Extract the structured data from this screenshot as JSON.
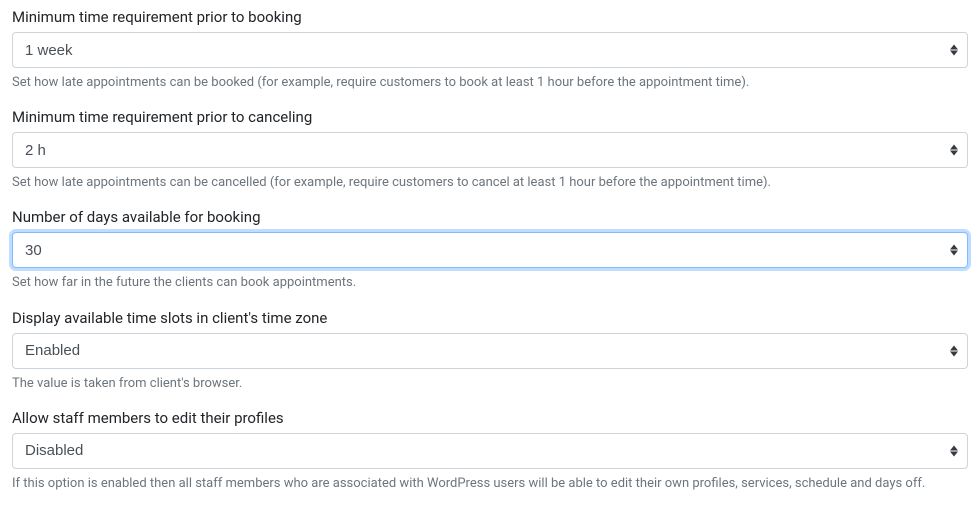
{
  "fields": {
    "min_time_booking": {
      "label": "Minimum time requirement prior to booking",
      "value": "1 week",
      "help": "Set how late appointments can be booked (for example, require customers to book at least 1 hour before the appointment time)."
    },
    "min_time_cancel": {
      "label": "Minimum time requirement prior to canceling",
      "value": "2 h",
      "help": "Set how late appointments can be cancelled (for example, require customers to cancel at least 1 hour before the appointment time)."
    },
    "days_available": {
      "label": "Number of days available for booking",
      "value": "30",
      "help": "Set how far in the future the clients can book appointments."
    },
    "client_timezone": {
      "label": "Display available time slots in client's time zone",
      "value": "Enabled",
      "help": "The value is taken from client's browser."
    },
    "staff_edit_profiles": {
      "label": "Allow staff members to edit their profiles",
      "value": "Disabled",
      "help": "If this option is enabled then all staff members who are associated with WordPress users will be able to edit their own profiles, services, schedule and days off."
    }
  }
}
